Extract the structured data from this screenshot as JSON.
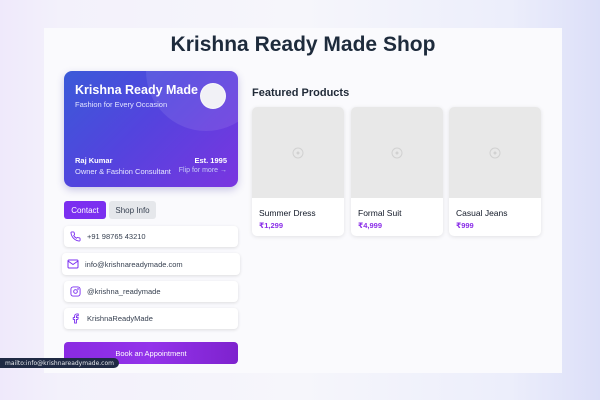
{
  "page": {
    "title": "Krishna Ready Made Shop"
  },
  "card": {
    "name": "Krishna Ready Made",
    "tagline": "Fashion for Every Occasion",
    "owner": "Raj Kumar",
    "role": "Owner & Fashion Consultant",
    "established": "Est. 1995",
    "flip_hint": "Flip for more →"
  },
  "tabs": [
    {
      "label": "Contact",
      "active": true
    },
    {
      "label": "Shop Info",
      "active": false
    }
  ],
  "contacts": [
    {
      "icon": "phone-icon",
      "text": "+91 98765 43210"
    },
    {
      "icon": "mail-icon",
      "text": "info@krishnareadymade.com"
    },
    {
      "icon": "instagram-icon",
      "text": "@krishna_readymade"
    },
    {
      "icon": "facebook-icon",
      "text": "KrishnaReadyMade"
    }
  ],
  "appointment_button": "Book an Appointment",
  "featured": {
    "title": "Featured Products",
    "products": [
      {
        "name": "Summer Dress",
        "price": "₹1,299"
      },
      {
        "name": "Formal Suit",
        "price": "₹4,999"
      },
      {
        "name": "Casual Jeans",
        "price": "₹999"
      }
    ]
  },
  "status_bar": "mailto:info@krishnareadymade.com",
  "colors": {
    "accent": "#7b2ff0",
    "card_gradient_start": "#3a5ad8",
    "card_gradient_end": "#7a35e0",
    "price": "#8b2fe8"
  }
}
